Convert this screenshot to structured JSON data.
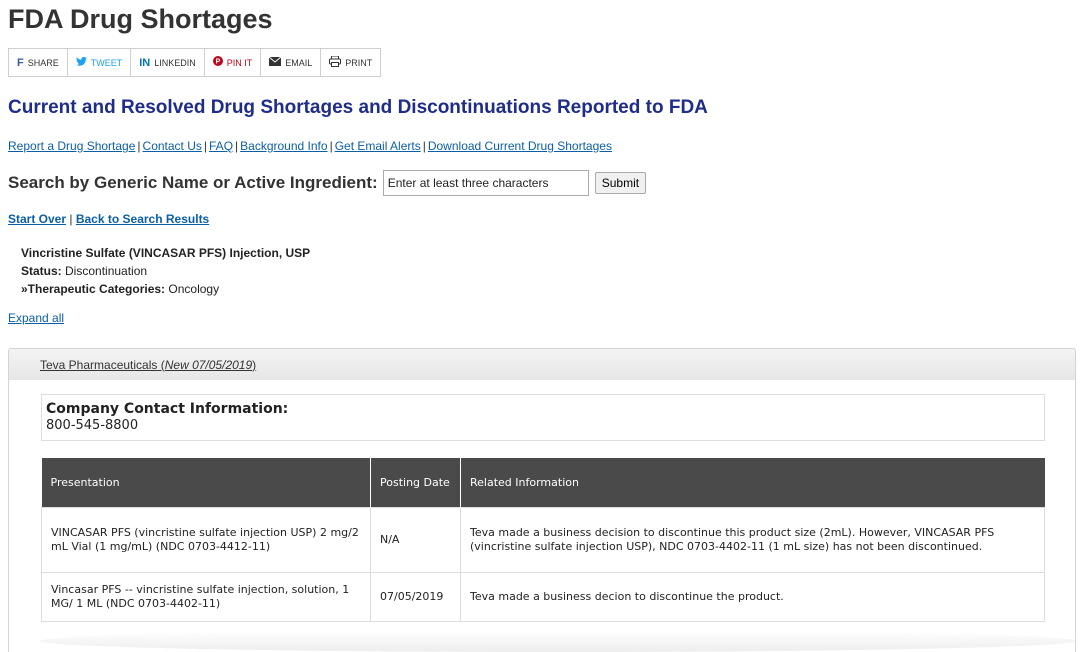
{
  "page_title": "FDA Drug Shortages",
  "share": [
    {
      "icon": "f",
      "label": "SHARE",
      "name": "facebook"
    },
    {
      "icon": "🐦",
      "label": "TWEET",
      "name": "twitter"
    },
    {
      "icon": "in",
      "label": "LINKEDIN",
      "name": "linkedin"
    },
    {
      "icon": "℗",
      "label": "PIN IT",
      "name": "pinterest"
    },
    {
      "icon": "✉",
      "label": "EMAIL",
      "name": "email"
    },
    {
      "icon": "⎙",
      "label": "PRINT",
      "name": "print"
    }
  ],
  "subtitle": "Current and Resolved Drug Shortages and Discontinuations Reported to FDA",
  "links": [
    "Report a Drug Shortage",
    "Contact Us",
    "FAQ",
    "Background Info",
    "Get Email Alerts",
    "Download Current Drug Shortages"
  ],
  "search": {
    "label": "Search by Generic Name or Active Ingredient:",
    "placeholder": "Enter at least three characters",
    "submit": "Submit"
  },
  "nav": {
    "start_over": "Start Over",
    "separator": "|",
    "back": "Back to Search Results"
  },
  "drug": {
    "name": "Vincristine Sulfate (VINCASAR PFS) Injection, USP",
    "status_label": "Status:",
    "status": "Discontinuation",
    "categories_label": "»Therapeutic Categories:",
    "categories": "Oncology"
  },
  "expand_all": "Expand all",
  "company": {
    "name": "Teva Pharmaceuticals",
    "note": "New 07/05/2019",
    "contact_title": "Company Contact Information:",
    "phone": "800-545-8800"
  },
  "table": {
    "headers": [
      "Presentation",
      "Posting Date",
      "Related Information"
    ],
    "rows": [
      {
        "presentation": "VINCASAR PFS (vincristine sulfate injection USP) 2 mg/2 mL Vial (1 mg/mL) (NDC 0703-4412-11)",
        "date": "N/A",
        "info": "Teva made a business decision to discontinue this product size (2mL). However, VINCASAR PFS (vincristine sulfate injection USP), NDC 0703-4402-11 (1 mL size) has not been discontinued."
      },
      {
        "presentation": "Vincasar PFS -- vincristine sulfate injection, solution, 1 MG/ 1 ML (NDC 0703-4402-11)",
        "date": "07/05/2019",
        "info": "Teva made a business decion to discontinue the product."
      }
    ]
  },
  "colors": {
    "title": "#333333",
    "subtitle": "#1f2d8a",
    "link": "#0b5fa5",
    "table_header": "#4a4a4a"
  }
}
